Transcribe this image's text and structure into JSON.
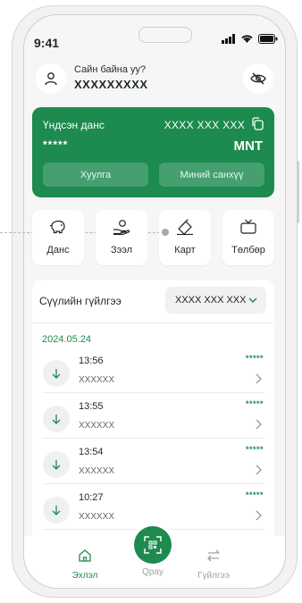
{
  "status_bar": {
    "time": "9:41"
  },
  "header": {
    "greeting": "Сайн байна уу?",
    "username": "XXXXXXXXX"
  },
  "account_card": {
    "type": "Үндсэн данс",
    "number": "XXXX XXX XXX",
    "balance": "*****",
    "currency": "MNT",
    "statement_label": "Хуулга",
    "savings_label": "Миний санхүү"
  },
  "quick_actions": [
    {
      "label": "Данс",
      "icon": "piggy-bank-icon"
    },
    {
      "label": "Зээл",
      "icon": "loan-hand-icon"
    },
    {
      "label": "Карт",
      "icon": "card-icon"
    },
    {
      "label": "Төлбөр",
      "icon": "tv-icon"
    }
  ],
  "transactions_panel": {
    "title": "Сүүлийн гүйлгээ",
    "account_selector": "XXXX XXX XXX",
    "date": "2024.05.24",
    "items": [
      {
        "time": "13:56",
        "description": "XXXXXX",
        "amount": "*****"
      },
      {
        "time": "13:55",
        "description": "XXXXXX",
        "amount": "*****"
      },
      {
        "time": "13:54",
        "description": "XXXXXX",
        "amount": "*****"
      },
      {
        "time": "10:27",
        "description": "XXXXXX",
        "amount": "*****"
      }
    ]
  },
  "bottom_nav": {
    "home_label": "Эхлэл",
    "qpay_label": "Qpay",
    "transfer_label": "Гүйлгээ"
  },
  "colors": {
    "brand_green": "#1d8a4f",
    "inactive_gray": "#9aa39e"
  }
}
